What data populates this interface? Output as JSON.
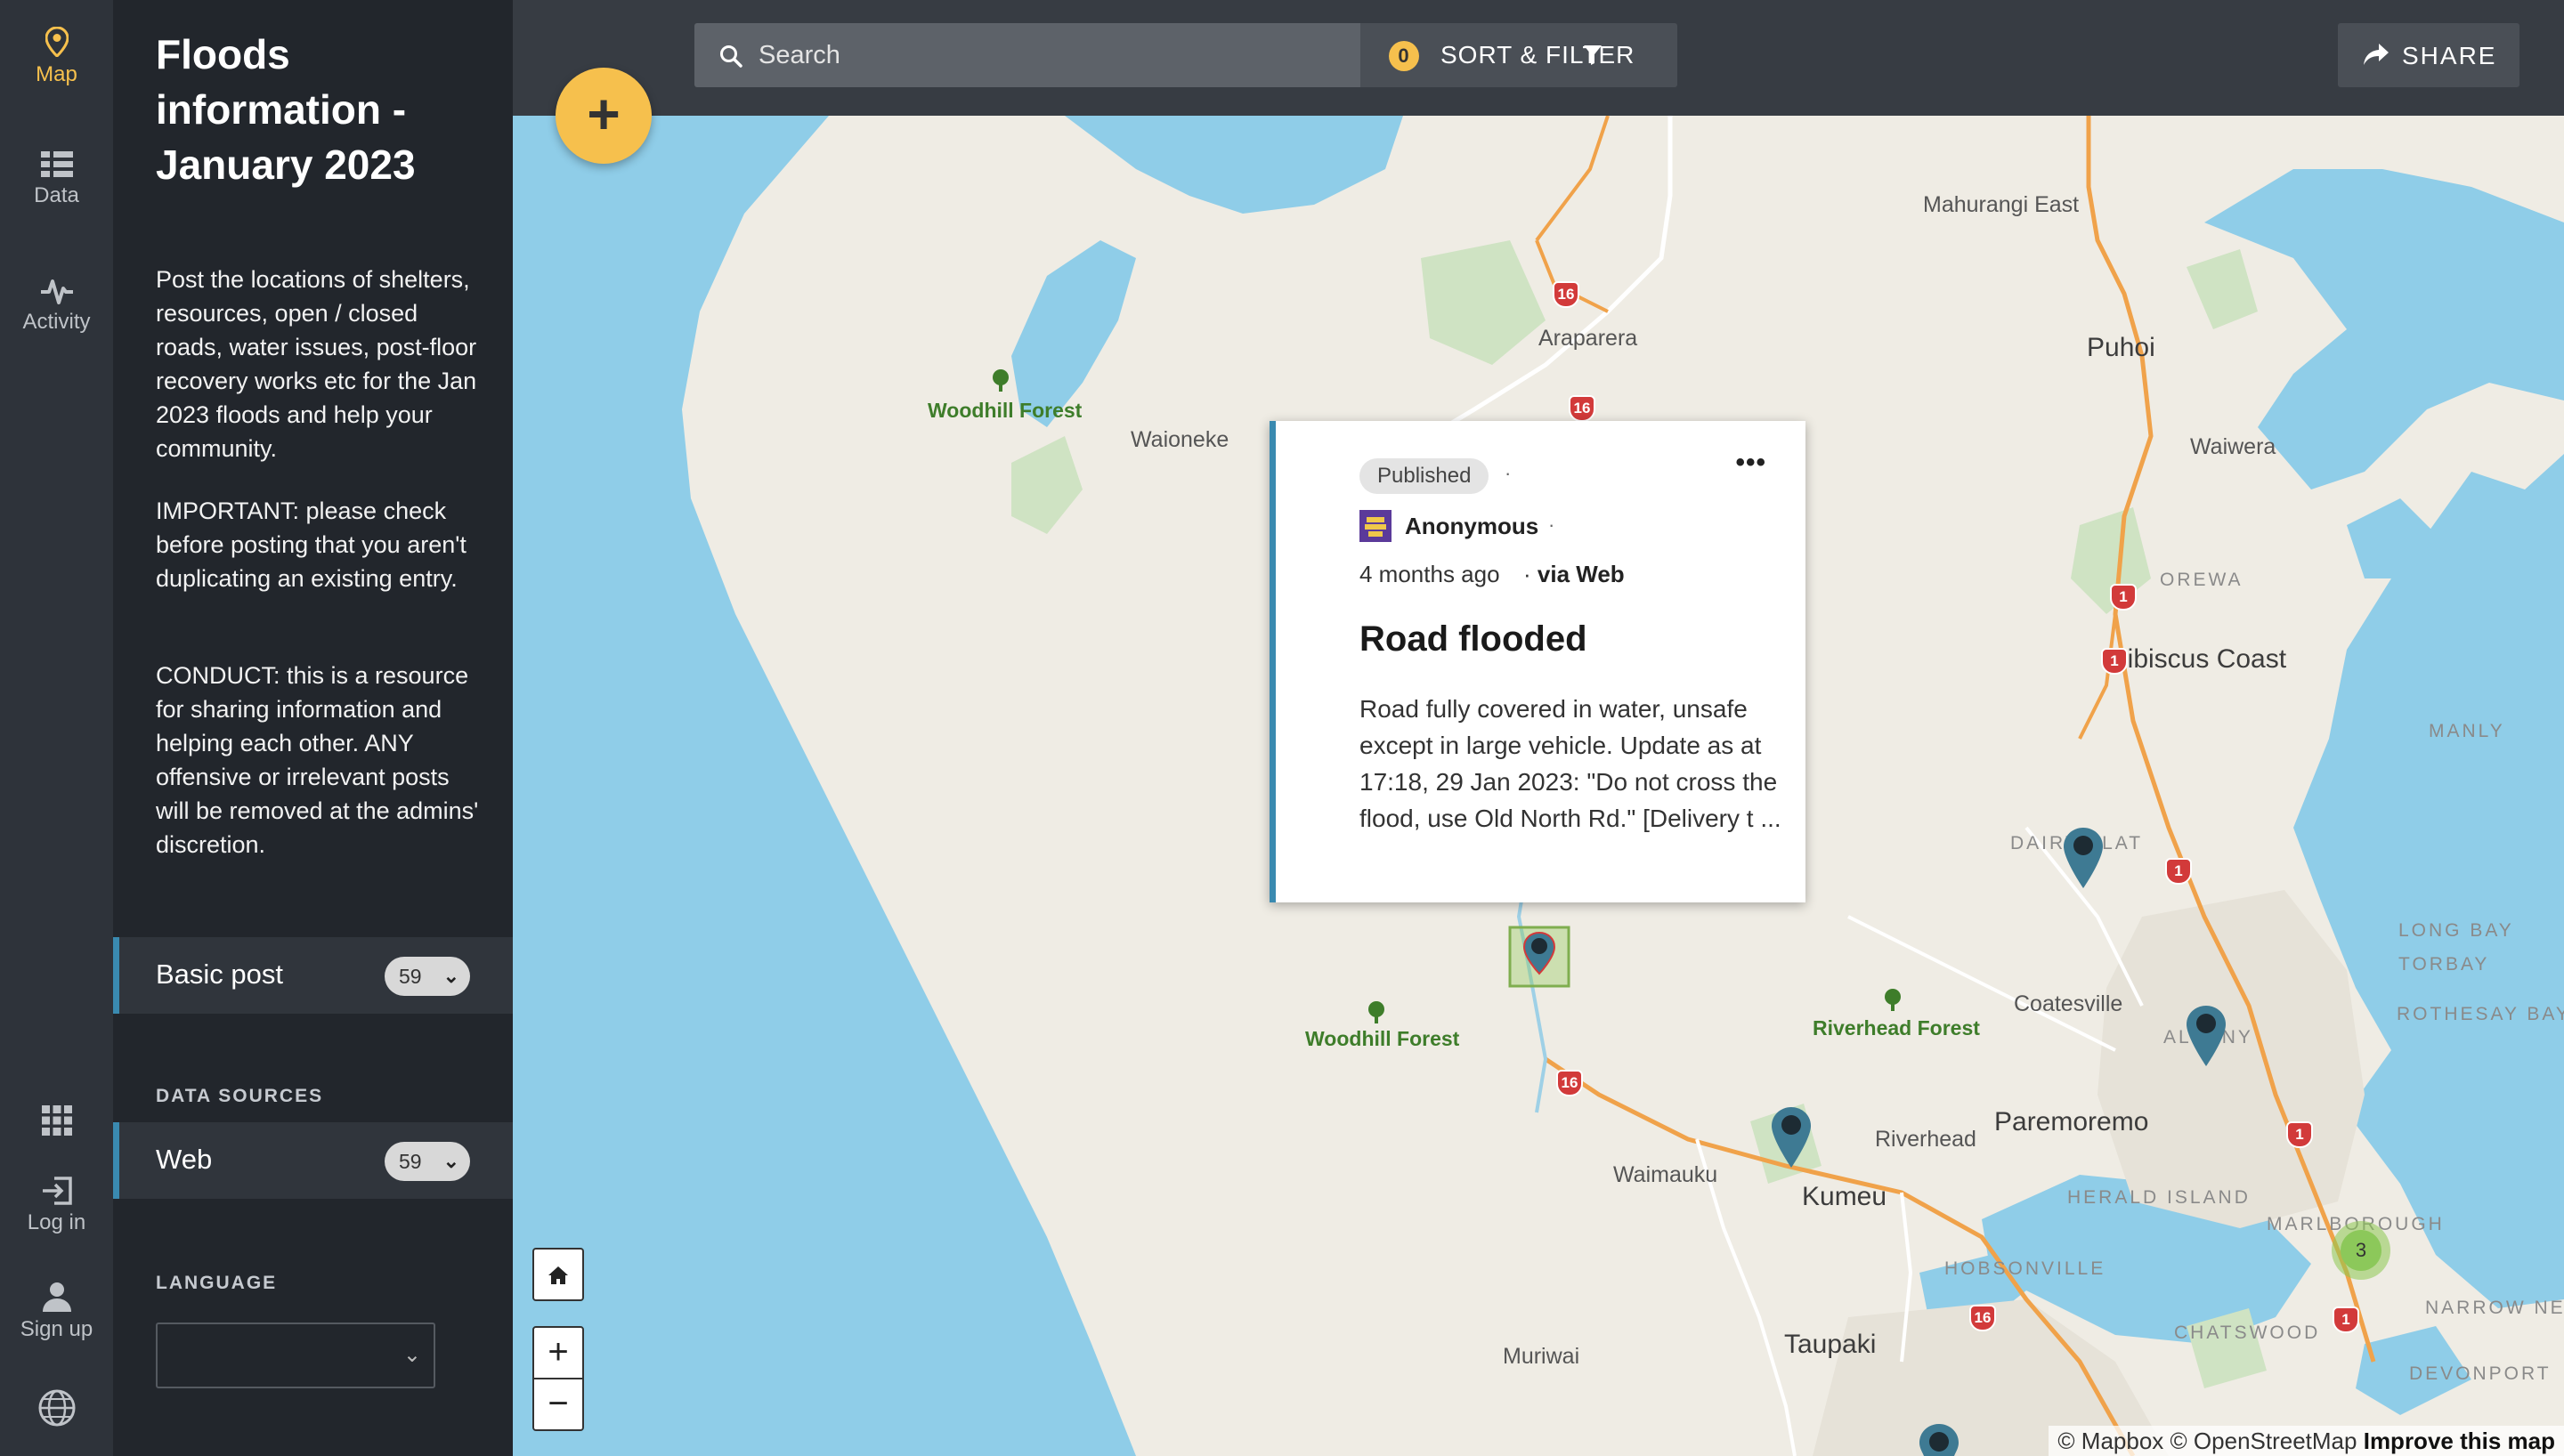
{
  "rail": {
    "map": "Map",
    "data": "Data",
    "activity": "Activity",
    "login": "Log in",
    "signup": "Sign up"
  },
  "sidebar": {
    "title": "Floods information - January 2023",
    "desc1": "Post the locations of shelters, resources, open / closed roads, water issues, post-floor recovery works etc for the Jan 2023 floods and help your community.",
    "desc2": "IMPORTANT: please check before posting that you aren't duplicating an existing entry.",
    "desc3": "CONDUCT: this is a resource for sharing information and helping each other. ANY offensive or irrelevant posts will be removed at the admins' discretion.",
    "survey": {
      "label": "Basic post",
      "count": "59"
    },
    "sources_heading": "DATA SOURCES",
    "source": {
      "label": "Web",
      "count": "59"
    },
    "language_heading": "LANGUAGE"
  },
  "topbar": {
    "search_placeholder": "Search",
    "filter_count": "0",
    "filter_label": "SORT & FILTER",
    "share_label": "SHARE"
  },
  "map": {
    "places": {
      "mahurangi_east": "Mahurangi East",
      "araparera": "Araparera",
      "puhoi": "Puhoi",
      "waiwera": "Waiwera",
      "woodhill_forest_1": "Woodhill Forest",
      "waioneke": "Waioneke",
      "orewa": "OREWA",
      "hibiscus_coast": "Hibiscus Coast",
      "manly": "MANLY",
      "dairy_flat": "DAIRY FLAT",
      "long_bay": "LONG BAY",
      "torbay": "TORBAY",
      "coatesville": "Coatesville",
      "rothesay_bay": "ROTHESAY BAY",
      "woodhill_forest_2": "Woodhill Forest",
      "riverhead_forest": "Riverhead Forest",
      "albany": "ALBANY",
      "riverhead": "Riverhead",
      "paremoremo": "Paremoremo",
      "waimauku": "Waimauku",
      "kumeu": "Kumeu",
      "herald_island": "HERALD ISLAND",
      "marlborough": "MARLBOROUGH",
      "hobsonville": "HOBSONVILLE",
      "narrow_neck": "NARROW NECK",
      "chatswood": "CHATSWOOD",
      "devonport": "DEVONPORT",
      "muriwai": "Muriwai",
      "taupaki": "Taupaki"
    },
    "shields": {
      "r16": "16",
      "r1": "1"
    },
    "cluster_count": "3",
    "attribution": {
      "mapbox": "© Mapbox",
      "osm": "© OpenStreetMap",
      "improve": "Improve this map"
    },
    "colors": {
      "water": "#8fcde8",
      "land": "#efece4",
      "accent": "#f6c04d",
      "marker": "#3e7a93"
    }
  },
  "popup": {
    "status": "Published",
    "author": "Anonymous",
    "time": "4 months ago",
    "via_prefix": "· ",
    "via_source": "via Web",
    "title": "Road flooded",
    "body": "Road fully covered in water, unsafe except in large vehicle. Update as at 17:18, 29 Jan 2023: \"Do not cross the flood, use Old North Rd.\" [Delivery t ..."
  },
  "controls": {
    "add": "+",
    "zoom_in": "+",
    "zoom_out": "−"
  }
}
